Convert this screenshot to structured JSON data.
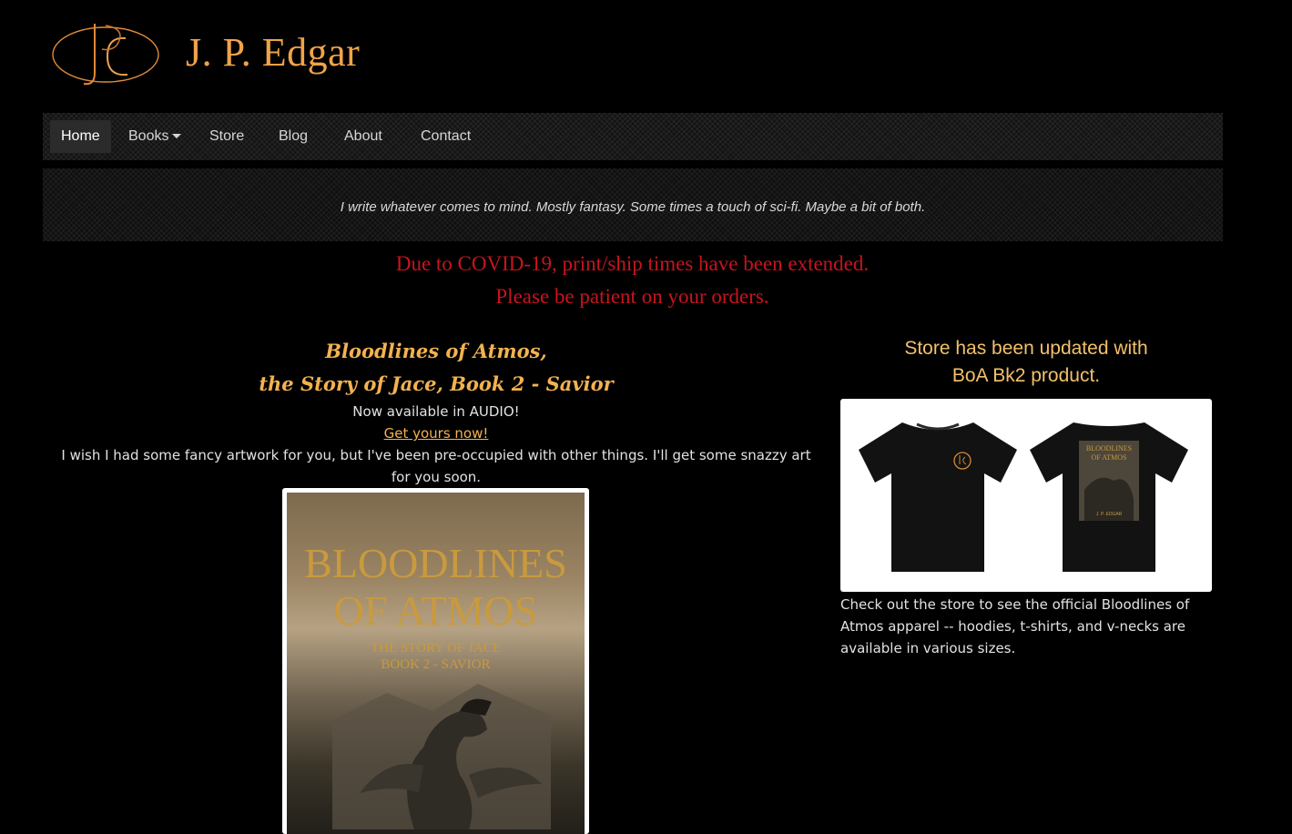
{
  "header": {
    "title": "J. P. Edgar",
    "logo_icon": "jpe-monogram-logo"
  },
  "nav": {
    "items": [
      {
        "label": "Home",
        "active": true
      },
      {
        "label": "Books",
        "dropdown": true
      },
      {
        "label": "Store"
      },
      {
        "label": "Blog"
      },
      {
        "label": "About"
      },
      {
        "label": "Contact"
      }
    ]
  },
  "tagline": "I write whatever comes to mind. Mostly fantasy. Some times a touch of sci-fi. Maybe a bit of both.",
  "notice": {
    "line1": "Due to COVID-19, print/ship times have been extended.",
    "line2": "Please be patient on your orders.",
    "color": "#c8141e"
  },
  "feature": {
    "title_line1": "Bloodlines of Atmos,",
    "title_line2": "the Story of Jace, Book 2 - Savior",
    "audio_text": "Now available in AUDIO!",
    "link_text": "Get yours now!",
    "description": "I wish I had some fancy artwork for you, but I've been pre-occupied with other things. I'll get some snazzy art for you soon.",
    "cover": {
      "title_line1": "BLOODLINES",
      "title_line2": "OF ATMOS",
      "subtitle_line1": "THE STORY OF JACE",
      "subtitle_line2": "BOOK 2 - SAVIOR"
    }
  },
  "store": {
    "heading_line1": "Store has been updated with",
    "heading_line2": "BoA Bk2 product.",
    "description": "Check out the store to see the official Bloodlines of Atmos apparel -- hoodies, t-shirts, and v-necks are available in various sizes.",
    "shirt_print": {
      "title": "BLOODLINES OF ATMOS",
      "author": "J. P. EDGAR"
    }
  },
  "colors": {
    "accent": "#f3b24f",
    "title": "#f0a34a",
    "background": "#000000"
  }
}
